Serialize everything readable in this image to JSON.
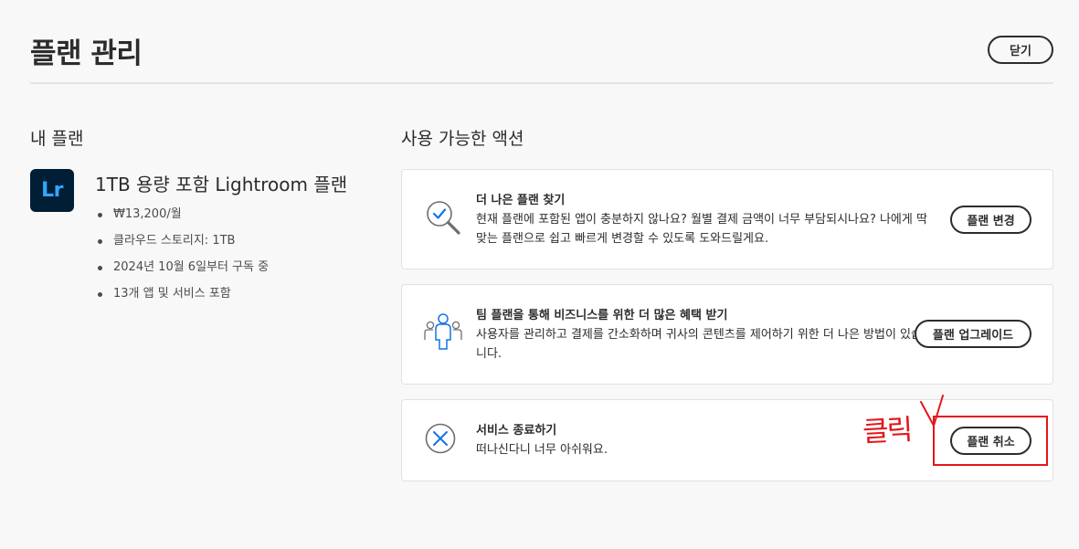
{
  "header": {
    "title": "플랜 관리",
    "close_label": "닫기"
  },
  "my_plan": {
    "section_title": "내 플랜",
    "app_icon": {
      "name": "lightroom-app-icon",
      "label": "Lr",
      "bg_color": "#001e36",
      "fg_color": "#31a8ff"
    },
    "plan_name": "1TB 용량 포함 Lightroom 플랜",
    "details": [
      "₩13,200/월",
      "클라우드 스토리지: 1TB",
      "2024년 10월 6일부터 구독 중",
      "13개 앱 및 서비스 포함"
    ]
  },
  "actions": {
    "section_title": "사용 가능한 액션",
    "cards": [
      {
        "icon": "search-check-icon",
        "heading": "더 나은 플랜 찾기",
        "description": "현재 플랜에 포함된 앱이 충분하지 않나요? 월별 결제 금액이 너무 부담되시나요? 나에게 딱 맞는 플랜으로 쉽고 빠르게 변경할 수 있도록 도와드릴게요.",
        "button_label": "플랜 변경"
      },
      {
        "icon": "team-icon",
        "heading": "팀 플랜을 통해 비즈니스를 위한 더 많은 혜택 받기",
        "description": "사용자를 관리하고 결제를 간소화하며 귀사의 콘텐츠를 제어하기 위한 더 나은 방법이 있습니다.",
        "button_label": "플랜 업그레이드"
      },
      {
        "icon": "cancel-circle-icon",
        "heading": "서비스 종료하기",
        "description": "떠나신다니 너무 아쉬워요.",
        "button_label": "플랜 취소"
      }
    ]
  },
  "annotation": {
    "text": "클릭",
    "color": "#e3161b"
  },
  "colors": {
    "background": "#f8f8f8",
    "text": "#2c2c2c",
    "icon_blue": "#1473e6"
  }
}
